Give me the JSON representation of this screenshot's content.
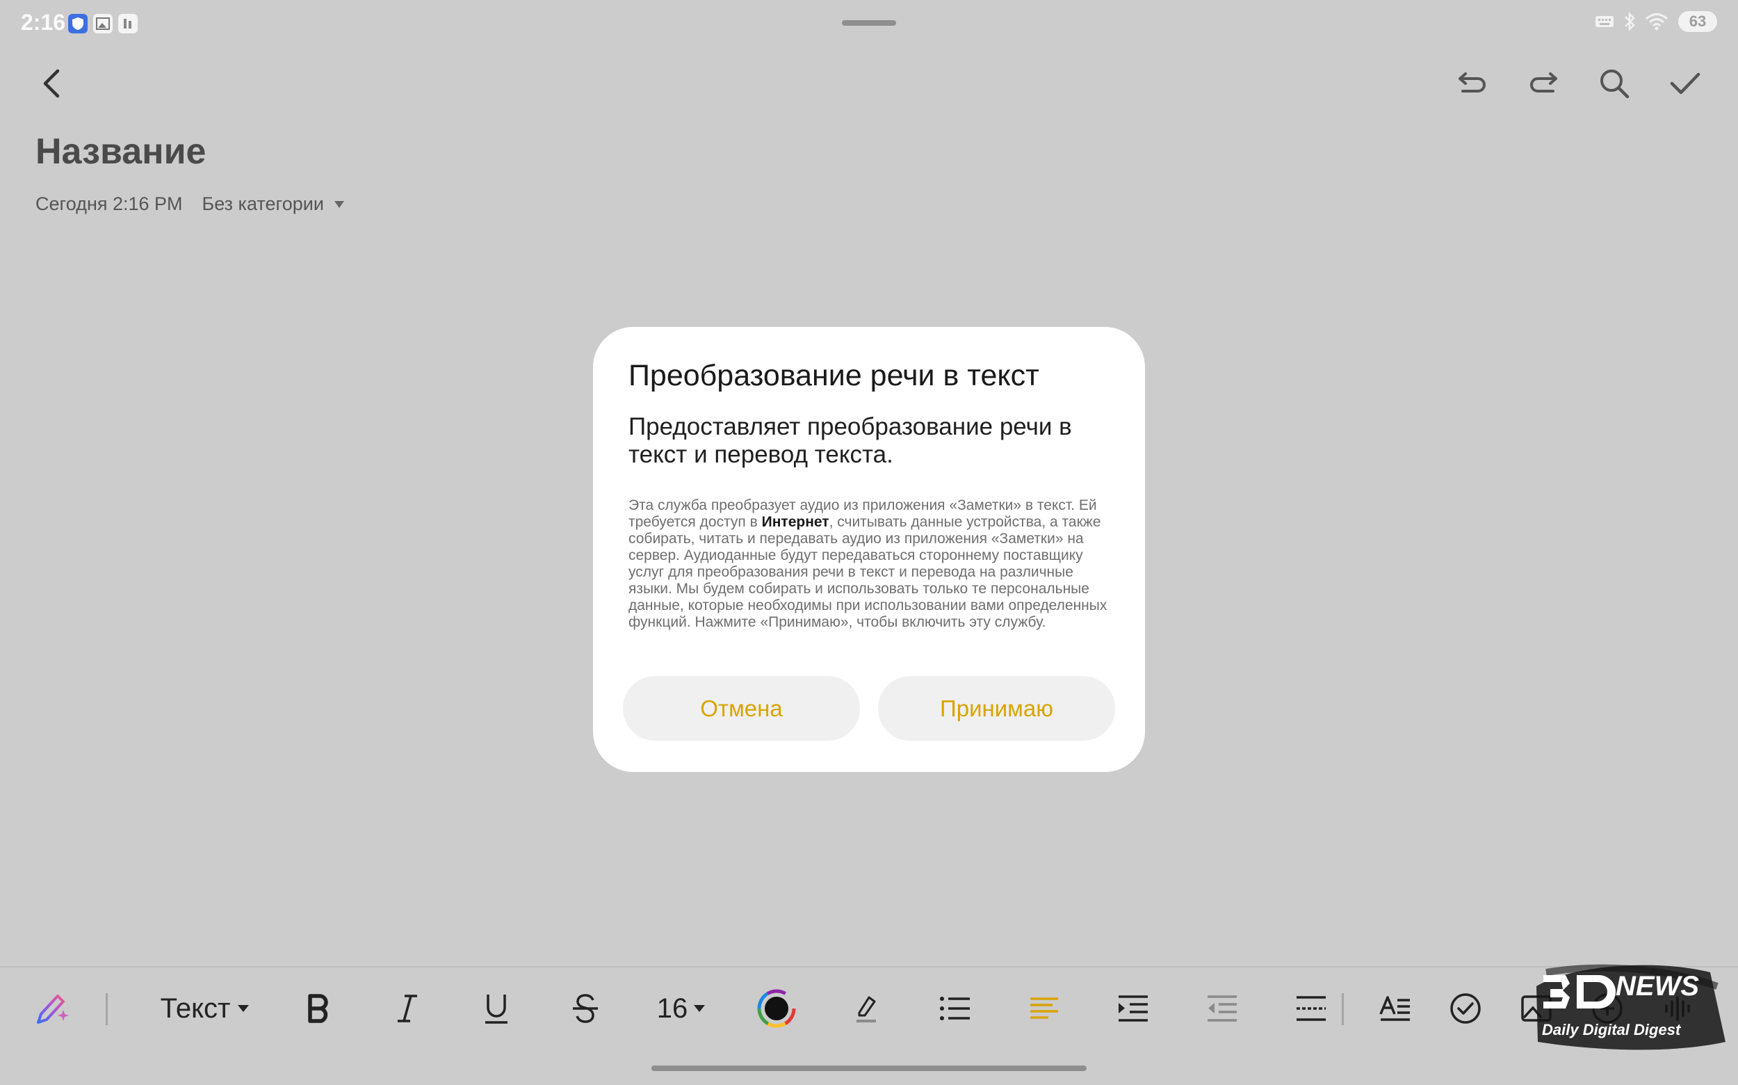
{
  "status_bar": {
    "time": "2:16",
    "battery": "63",
    "icons": [
      "shield-icon",
      "gallery-icon",
      "app-icon"
    ],
    "right_icons": [
      "keyboard-icon",
      "bluetooth-icon",
      "wifi-icon",
      "battery-icon"
    ]
  },
  "toolbar": {
    "icons": [
      "back-icon",
      "undo-icon",
      "redo-icon",
      "search-icon",
      "check-icon"
    ]
  },
  "note": {
    "title": "Название",
    "date": "Сегодня 2:16 PM",
    "category": "Без категории"
  },
  "dialog": {
    "title": "Преобразование речи в текст",
    "subtitle": "Предоставляет преобразование речи в текст и перевод текста.",
    "body_before": "Эта служба преобразует аудио из приложения «Заметки» в текст. Ей требуется доступ в ",
    "body_bold": "Интернет",
    "body_after": ", считывать данные устройства, а также собирать, читать и передавать аудио из приложения «Заметки» на сервер. Аудиоданные будут передаваться стороннему поставщику услуг для преобразования речи в текст и перевода на различные языки. Мы будем собирать и использовать только те персональные данные, которые необходимы при использовании вами определенных функций. Нажмите «Принимаю», чтобы включить эту службу.",
    "cancel": "Отмена",
    "accept": "Принимаю",
    "accent_color": "#d9a400"
  },
  "format_bar": {
    "text_style": "Текст",
    "font_size": "16"
  },
  "watermark": {
    "news": "NEWS",
    "tagline": "Daily Digital Digest"
  }
}
